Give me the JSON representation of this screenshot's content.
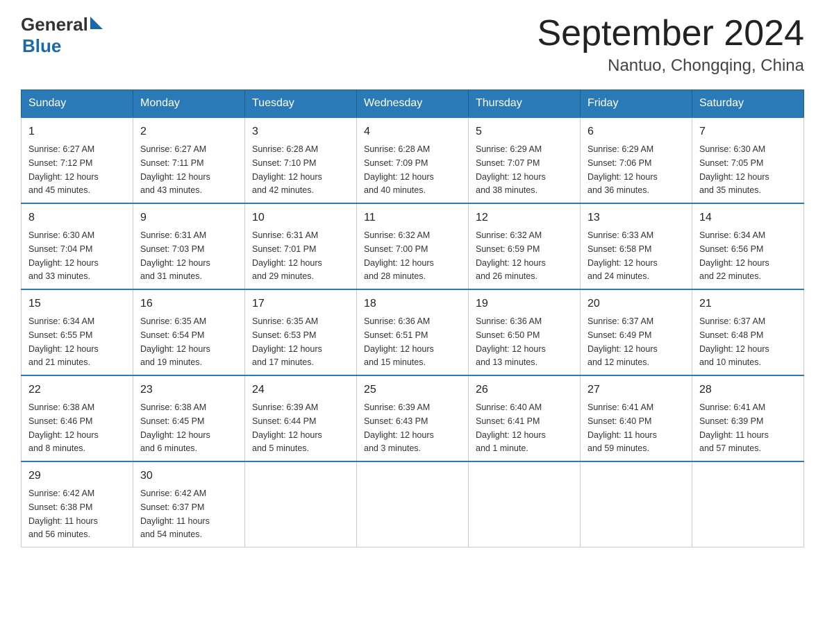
{
  "header": {
    "logo_general": "General",
    "logo_blue": "Blue",
    "title": "September 2024",
    "subtitle": "Nantuo, Chongqing, China"
  },
  "days_of_week": [
    "Sunday",
    "Monday",
    "Tuesday",
    "Wednesday",
    "Thursday",
    "Friday",
    "Saturday"
  ],
  "weeks": [
    [
      {
        "day": "1",
        "sunrise": "6:27 AM",
        "sunset": "7:12 PM",
        "daylight": "12 hours and 45 minutes."
      },
      {
        "day": "2",
        "sunrise": "6:27 AM",
        "sunset": "7:11 PM",
        "daylight": "12 hours and 43 minutes."
      },
      {
        "day": "3",
        "sunrise": "6:28 AM",
        "sunset": "7:10 PM",
        "daylight": "12 hours and 42 minutes."
      },
      {
        "day": "4",
        "sunrise": "6:28 AM",
        "sunset": "7:09 PM",
        "daylight": "12 hours and 40 minutes."
      },
      {
        "day": "5",
        "sunrise": "6:29 AM",
        "sunset": "7:07 PM",
        "daylight": "12 hours and 38 minutes."
      },
      {
        "day": "6",
        "sunrise": "6:29 AM",
        "sunset": "7:06 PM",
        "daylight": "12 hours and 36 minutes."
      },
      {
        "day": "7",
        "sunrise": "6:30 AM",
        "sunset": "7:05 PM",
        "daylight": "12 hours and 35 minutes."
      }
    ],
    [
      {
        "day": "8",
        "sunrise": "6:30 AM",
        "sunset": "7:04 PM",
        "daylight": "12 hours and 33 minutes."
      },
      {
        "day": "9",
        "sunrise": "6:31 AM",
        "sunset": "7:03 PM",
        "daylight": "12 hours and 31 minutes."
      },
      {
        "day": "10",
        "sunrise": "6:31 AM",
        "sunset": "7:01 PM",
        "daylight": "12 hours and 29 minutes."
      },
      {
        "day": "11",
        "sunrise": "6:32 AM",
        "sunset": "7:00 PM",
        "daylight": "12 hours and 28 minutes."
      },
      {
        "day": "12",
        "sunrise": "6:32 AM",
        "sunset": "6:59 PM",
        "daylight": "12 hours and 26 minutes."
      },
      {
        "day": "13",
        "sunrise": "6:33 AM",
        "sunset": "6:58 PM",
        "daylight": "12 hours and 24 minutes."
      },
      {
        "day": "14",
        "sunrise": "6:34 AM",
        "sunset": "6:56 PM",
        "daylight": "12 hours and 22 minutes."
      }
    ],
    [
      {
        "day": "15",
        "sunrise": "6:34 AM",
        "sunset": "6:55 PM",
        "daylight": "12 hours and 21 minutes."
      },
      {
        "day": "16",
        "sunrise": "6:35 AM",
        "sunset": "6:54 PM",
        "daylight": "12 hours and 19 minutes."
      },
      {
        "day": "17",
        "sunrise": "6:35 AM",
        "sunset": "6:53 PM",
        "daylight": "12 hours and 17 minutes."
      },
      {
        "day": "18",
        "sunrise": "6:36 AM",
        "sunset": "6:51 PM",
        "daylight": "12 hours and 15 minutes."
      },
      {
        "day": "19",
        "sunrise": "6:36 AM",
        "sunset": "6:50 PM",
        "daylight": "12 hours and 13 minutes."
      },
      {
        "day": "20",
        "sunrise": "6:37 AM",
        "sunset": "6:49 PM",
        "daylight": "12 hours and 12 minutes."
      },
      {
        "day": "21",
        "sunrise": "6:37 AM",
        "sunset": "6:48 PM",
        "daylight": "12 hours and 10 minutes."
      }
    ],
    [
      {
        "day": "22",
        "sunrise": "6:38 AM",
        "sunset": "6:46 PM",
        "daylight": "12 hours and 8 minutes."
      },
      {
        "day": "23",
        "sunrise": "6:38 AM",
        "sunset": "6:45 PM",
        "daylight": "12 hours and 6 minutes."
      },
      {
        "day": "24",
        "sunrise": "6:39 AM",
        "sunset": "6:44 PM",
        "daylight": "12 hours and 5 minutes."
      },
      {
        "day": "25",
        "sunrise": "6:39 AM",
        "sunset": "6:43 PM",
        "daylight": "12 hours and 3 minutes."
      },
      {
        "day": "26",
        "sunrise": "6:40 AM",
        "sunset": "6:41 PM",
        "daylight": "12 hours and 1 minute."
      },
      {
        "day": "27",
        "sunrise": "6:41 AM",
        "sunset": "6:40 PM",
        "daylight": "11 hours and 59 minutes."
      },
      {
        "day": "28",
        "sunrise": "6:41 AM",
        "sunset": "6:39 PM",
        "daylight": "11 hours and 57 minutes."
      }
    ],
    [
      {
        "day": "29",
        "sunrise": "6:42 AM",
        "sunset": "6:38 PM",
        "daylight": "11 hours and 56 minutes."
      },
      {
        "day": "30",
        "sunrise": "6:42 AM",
        "sunset": "6:37 PM",
        "daylight": "11 hours and 54 minutes."
      },
      null,
      null,
      null,
      null,
      null
    ]
  ],
  "labels": {
    "sunrise": "Sunrise:",
    "sunset": "Sunset:",
    "daylight": "Daylight:"
  }
}
